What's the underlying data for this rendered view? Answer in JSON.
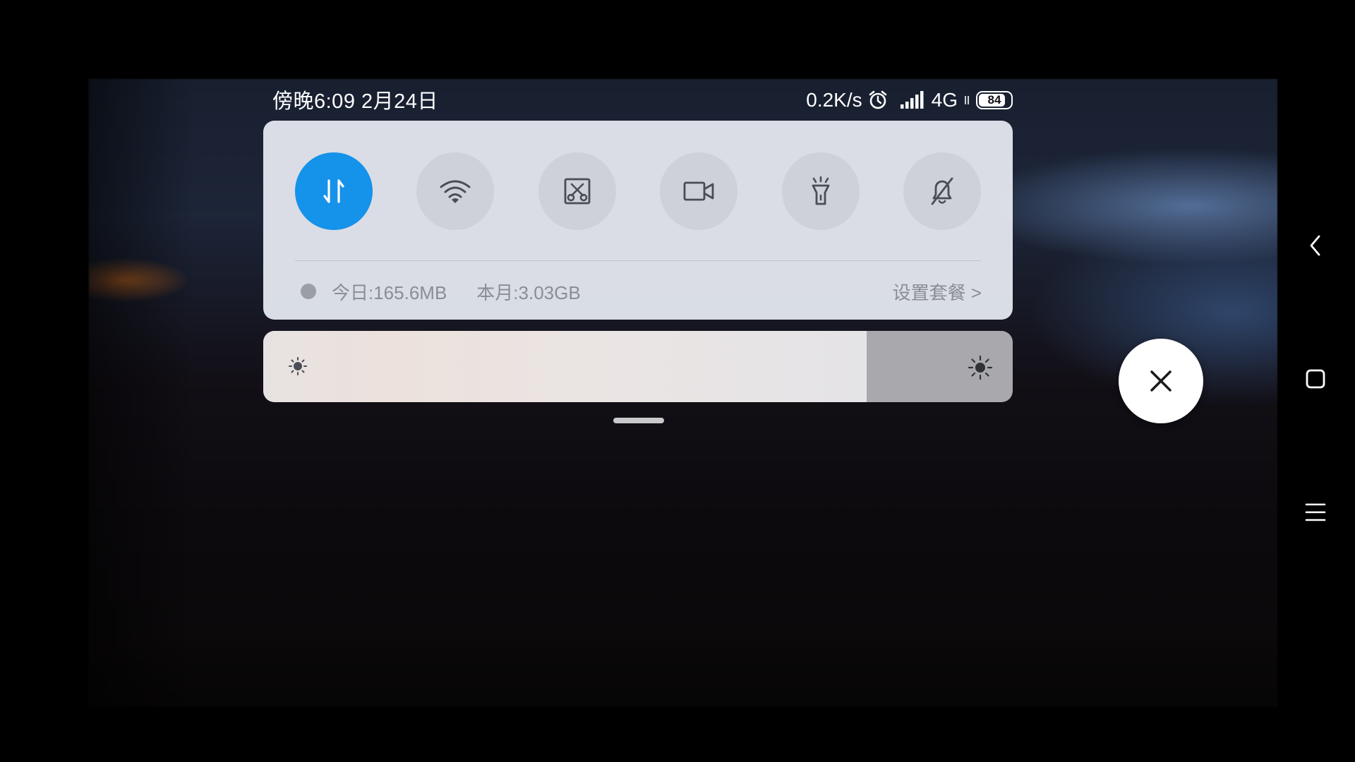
{
  "status_bar": {
    "time_date": "傍晚6:09 2月24日",
    "net_speed": "0.2K/s",
    "network_type": "4G",
    "battery_level": "84",
    "icons": [
      "alarm-icon",
      "signal-icon",
      "battery-icon"
    ]
  },
  "quick_settings": {
    "toggles": [
      {
        "name": "mobile-data-icon",
        "active": true
      },
      {
        "name": "wifi-icon",
        "active": false
      },
      {
        "name": "screenshot-icon",
        "active": false
      },
      {
        "name": "screen-record-icon",
        "active": false
      },
      {
        "name": "flashlight-icon",
        "active": false
      },
      {
        "name": "mute-icon",
        "active": false
      }
    ],
    "accent_color": "#1592ea",
    "data_usage": {
      "today": "今日:165.6MB",
      "month": "本月:3.03GB",
      "plan_link": "设置套餐 >"
    }
  },
  "brightness": {
    "level": 0.805
  },
  "floating_button": {
    "icon": "close-icon"
  },
  "nav_bar": {
    "items": [
      "back-icon",
      "home-icon",
      "menu-icon"
    ]
  }
}
